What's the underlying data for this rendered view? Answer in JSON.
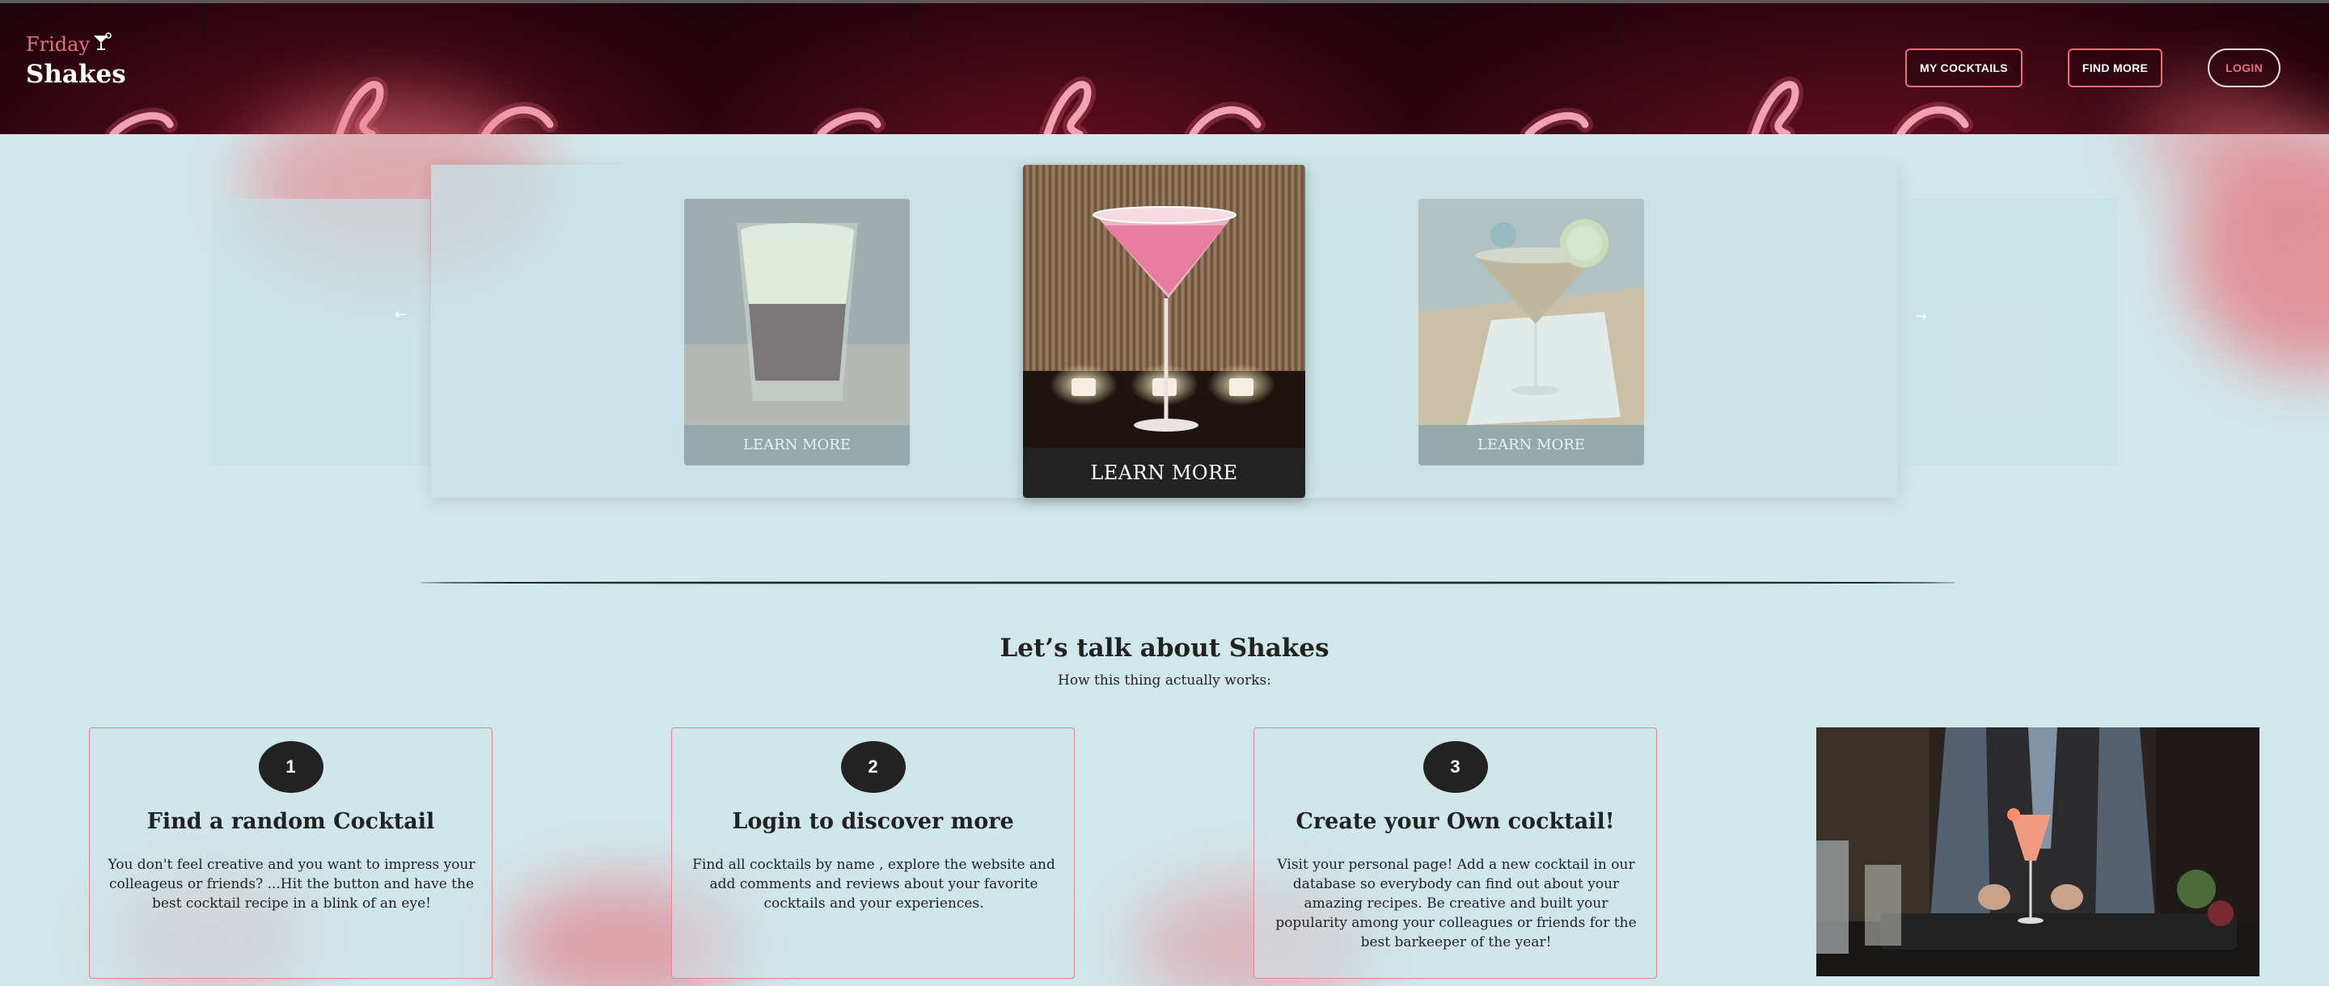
{
  "header": {
    "logo_top": "Friday",
    "logo_bottom": "Shakes",
    "nav": {
      "my_cocktails": "MY COCKTAILS",
      "find_more": "FIND MORE",
      "login": "LOGIN"
    }
  },
  "carousel": {
    "cards": [
      {
        "button": "LEARN MORE",
        "image": "layered-shot-glass"
      },
      {
        "button": "LEARN MORE",
        "image": "pink-martini-with-candles"
      },
      {
        "button": "LEARN MORE",
        "image": "martini-with-lime-garnish"
      }
    ],
    "prev_icon": "arrow-left-icon",
    "next_icon": "arrow-right-icon"
  },
  "about": {
    "title": "Let’s talk about Shakes",
    "subtitle": "How this thing actually works:",
    "steps": [
      {
        "number": "1",
        "title": "Find a random Cocktail",
        "text": "You don't feel creative and you want to impress your colleageus or friends? ...Hit the button and have the best cocktail recipe in a blink of an eye!"
      },
      {
        "number": "2",
        "title": "Login to discover more",
        "text": "Find all cocktails by name , explore the website and add comments and reviews about your favorite cocktails and your experiences."
      },
      {
        "number": "3",
        "title": "Create your Own cocktail!",
        "text": "Visit your personal page! Add a new cocktail in our database so everybody can find out about your amazing recipes. Be creative and built your popularity among your colleagues or friends for the best barkeeper of the year!"
      }
    ],
    "image": "bartender-pouring-pink-cocktail"
  },
  "colors": {
    "accent": "#e8707e",
    "background": "#d1e8eb",
    "dark": "#222222",
    "header": "#3b0714"
  }
}
